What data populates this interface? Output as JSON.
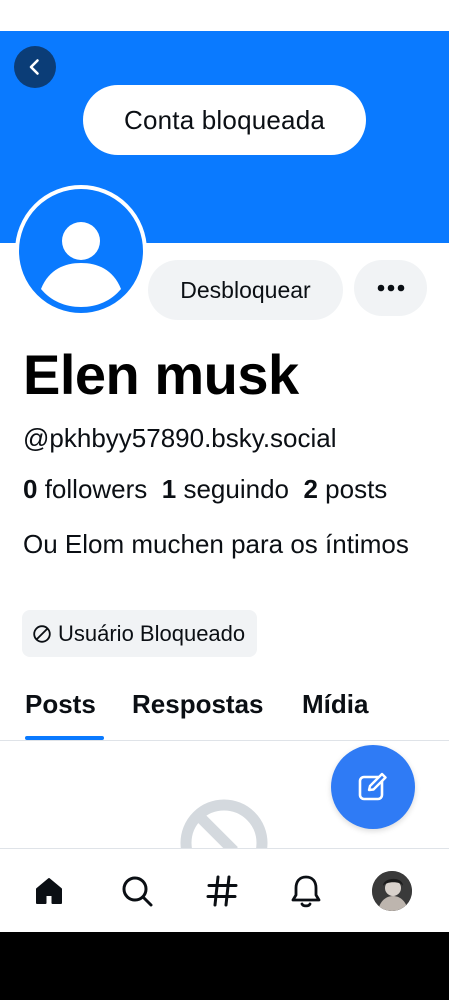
{
  "header": {
    "back_icon": "chevron-left-icon",
    "blocked_banner_label": "Conta bloqueada",
    "banner_color": "#0a7aff"
  },
  "profile": {
    "display_name": "Elen musk",
    "handle": "@pkhbyy57890.bsky.social",
    "followers_count": "0",
    "followers_label": "followers",
    "following_count": "1",
    "following_label": "seguindo",
    "posts_count": "2",
    "posts_label": "posts",
    "bio": "Ou Elom muchen para os íntimos",
    "blocked_badge_label": "Usuário Bloqueado"
  },
  "actions": {
    "unblock_label": "Desbloquear",
    "more_icon": "more-horizontal-icon"
  },
  "tabs": [
    {
      "label": "Posts",
      "selected": true
    },
    {
      "label": "Respostas",
      "selected": false
    },
    {
      "label": "Mídia",
      "selected": false
    }
  ],
  "fab": {
    "icon": "compose-icon",
    "color": "#2f7bf5"
  },
  "bottom_nav": [
    {
      "name": "home",
      "icon": "home-icon",
      "active": true
    },
    {
      "name": "search",
      "icon": "search-icon",
      "active": false
    },
    {
      "name": "feeds",
      "icon": "hashtag-icon",
      "active": false
    },
    {
      "name": "notifications",
      "icon": "bell-icon",
      "active": false
    },
    {
      "name": "profile",
      "icon": "avatar",
      "active": false
    }
  ],
  "colors": {
    "accent": "#0a7aff",
    "chip_bg": "#f1f3f5",
    "text": "#0b0f14"
  }
}
